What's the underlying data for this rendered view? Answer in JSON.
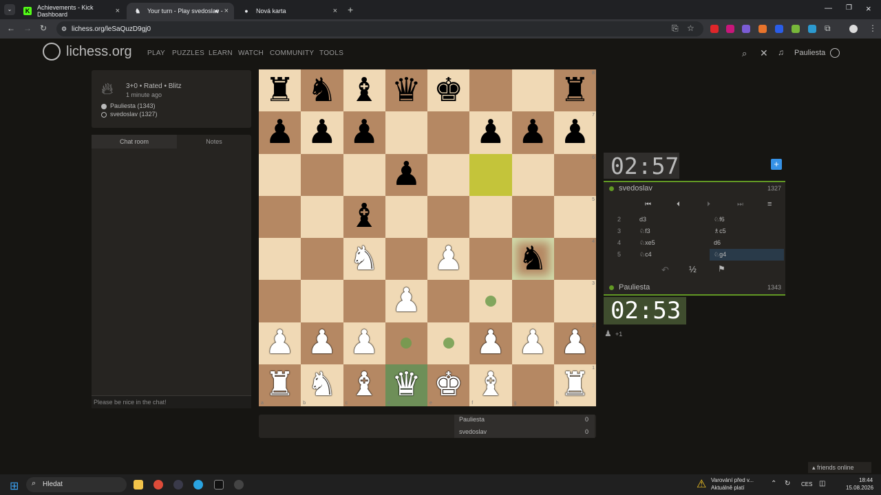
{
  "browser": {
    "tabs": [
      {
        "title": "Achievements - Kick Dashboard",
        "icon": "K"
      },
      {
        "title": "Your turn - Play svedoslav -",
        "icon": "♞"
      },
      {
        "title": "Nová karta",
        "icon": "●"
      }
    ],
    "url": "lichess.org/leSaQuzD9gj0"
  },
  "site": {
    "logo": "lichess.org",
    "nav": [
      "PLAY",
      "PUZZLES",
      "LEARN",
      "WATCH",
      "COMMUNITY",
      "TOOLS"
    ],
    "username": "Pauliesta"
  },
  "game": {
    "type": "3+0 • Rated • Blitz",
    "started": "1 minute ago",
    "white_player": "Pauliesta (1343)",
    "black_player": "svedoslav (1327)"
  },
  "chat": {
    "tabs": [
      "Chat room",
      "Notes"
    ],
    "placeholder": "Please be nice in the chat!"
  },
  "board": {
    "rows": [
      [
        "♜",
        "♞",
        "♝",
        "♛",
        "♚",
        "",
        "",
        "♜"
      ],
      [
        "♟",
        "♟",
        "♟",
        "",
        "",
        "♟",
        "♟",
        "♟"
      ],
      [
        "",
        "",
        "",
        "♟",
        "",
        "",
        "",
        ""
      ],
      [
        "",
        "",
        "♝",
        "",
        "",
        "",
        "",
        ""
      ],
      [
        "",
        "",
        "♞",
        "",
        "♟",
        "",
        "♞",
        ""
      ],
      [
        "",
        "",
        "",
        "♟",
        "",
        "",
        "",
        ""
      ],
      [
        "♟",
        "♟",
        "♟",
        "",
        "",
        "♟",
        "♟",
        "♟"
      ],
      [
        "♜",
        "♞",
        "♝",
        "♛",
        "♚",
        "♝",
        "",
        "♜"
      ]
    ],
    "colors": [
      [
        "b",
        "b",
        "b",
        "b",
        "b",
        "",
        "",
        "b"
      ],
      [
        "b",
        "b",
        "b",
        "",
        "",
        "b",
        "b",
        "b"
      ],
      [
        "",
        "",
        "",
        "b",
        "",
        "",
        "",
        ""
      ],
      [
        "",
        "",
        "b",
        "",
        "",
        "",
        "",
        ""
      ],
      [
        "",
        "",
        "w",
        "",
        "w",
        "",
        "b",
        ""
      ],
      [
        "",
        "",
        "",
        "w",
        "",
        "",
        "",
        ""
      ],
      [
        "w",
        "w",
        "w",
        "",
        "",
        "w",
        "w",
        "w"
      ],
      [
        "w",
        "w",
        "w",
        "w",
        "w",
        "w",
        "",
        "w"
      ]
    ],
    "rank_labels": [
      "8",
      "7",
      "6",
      "5",
      "4",
      "3",
      "2",
      "1"
    ],
    "file_labels": [
      "a",
      "b",
      "c",
      "d",
      "e",
      "f",
      "g",
      "h"
    ]
  },
  "clocks": {
    "opponent": {
      "time": "02:57",
      "name": "svedoslav",
      "rating": "1327"
    },
    "player": {
      "time": "02:53",
      "name": "Pauliesta",
      "rating": "1343"
    }
  },
  "moves": [
    {
      "num": "2",
      "white": "d3",
      "black": "♘f6"
    },
    {
      "num": "3",
      "white": "♘f3",
      "black": "♗c5"
    },
    {
      "num": "4",
      "white": "♘xe5",
      "black": "d6"
    },
    {
      "num": "5",
      "white": "♘c4",
      "black": "♘g4"
    }
  ],
  "spectators": "+1",
  "score": {
    "rows": [
      {
        "name": "Pauliesta",
        "points": "0"
      },
      {
        "name": "svedoslav",
        "points": "0"
      }
    ]
  },
  "friends_online": "friends online",
  "taskbar": {
    "search": "Hledat",
    "notification_line1": "Varování před v...",
    "notification_line2": "Aktuálně platí",
    "lang": "CES",
    "time": "18:44",
    "date": "15.08.2026"
  },
  "colors": {
    "accent": "#629924",
    "board_light": "#f0d9b5",
    "board_dark": "#b58863"
  }
}
